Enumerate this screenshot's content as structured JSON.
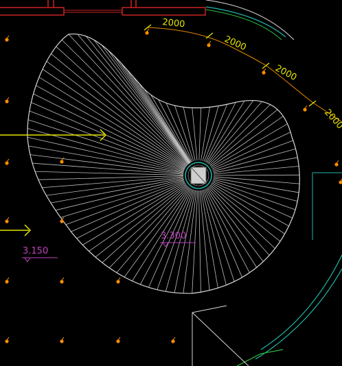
{
  "drawing": {
    "dimensions": [
      {
        "label": "2000"
      },
      {
        "label": "2000"
      },
      {
        "label": "2000"
      },
      {
        "label": "2000"
      }
    ],
    "elevations": [
      {
        "label": "3.150"
      },
      {
        "label": "3.300"
      }
    ],
    "ray_count": 96,
    "colors": {
      "background": "#000000",
      "outline": "#d9d9d9",
      "rays": "#bfbfbf",
      "dimension": "#e6e600",
      "dimension_line": "#e68a00",
      "elevation": "#c040c0",
      "boundary_cyan": "#1fb8a8",
      "boundary_green": "#2fbf3a",
      "wall_red": "#cc2222",
      "arrow_yellow": "#e6e600",
      "light_marker": "#ff8c00",
      "column_ring": "#1fb8a8"
    }
  }
}
